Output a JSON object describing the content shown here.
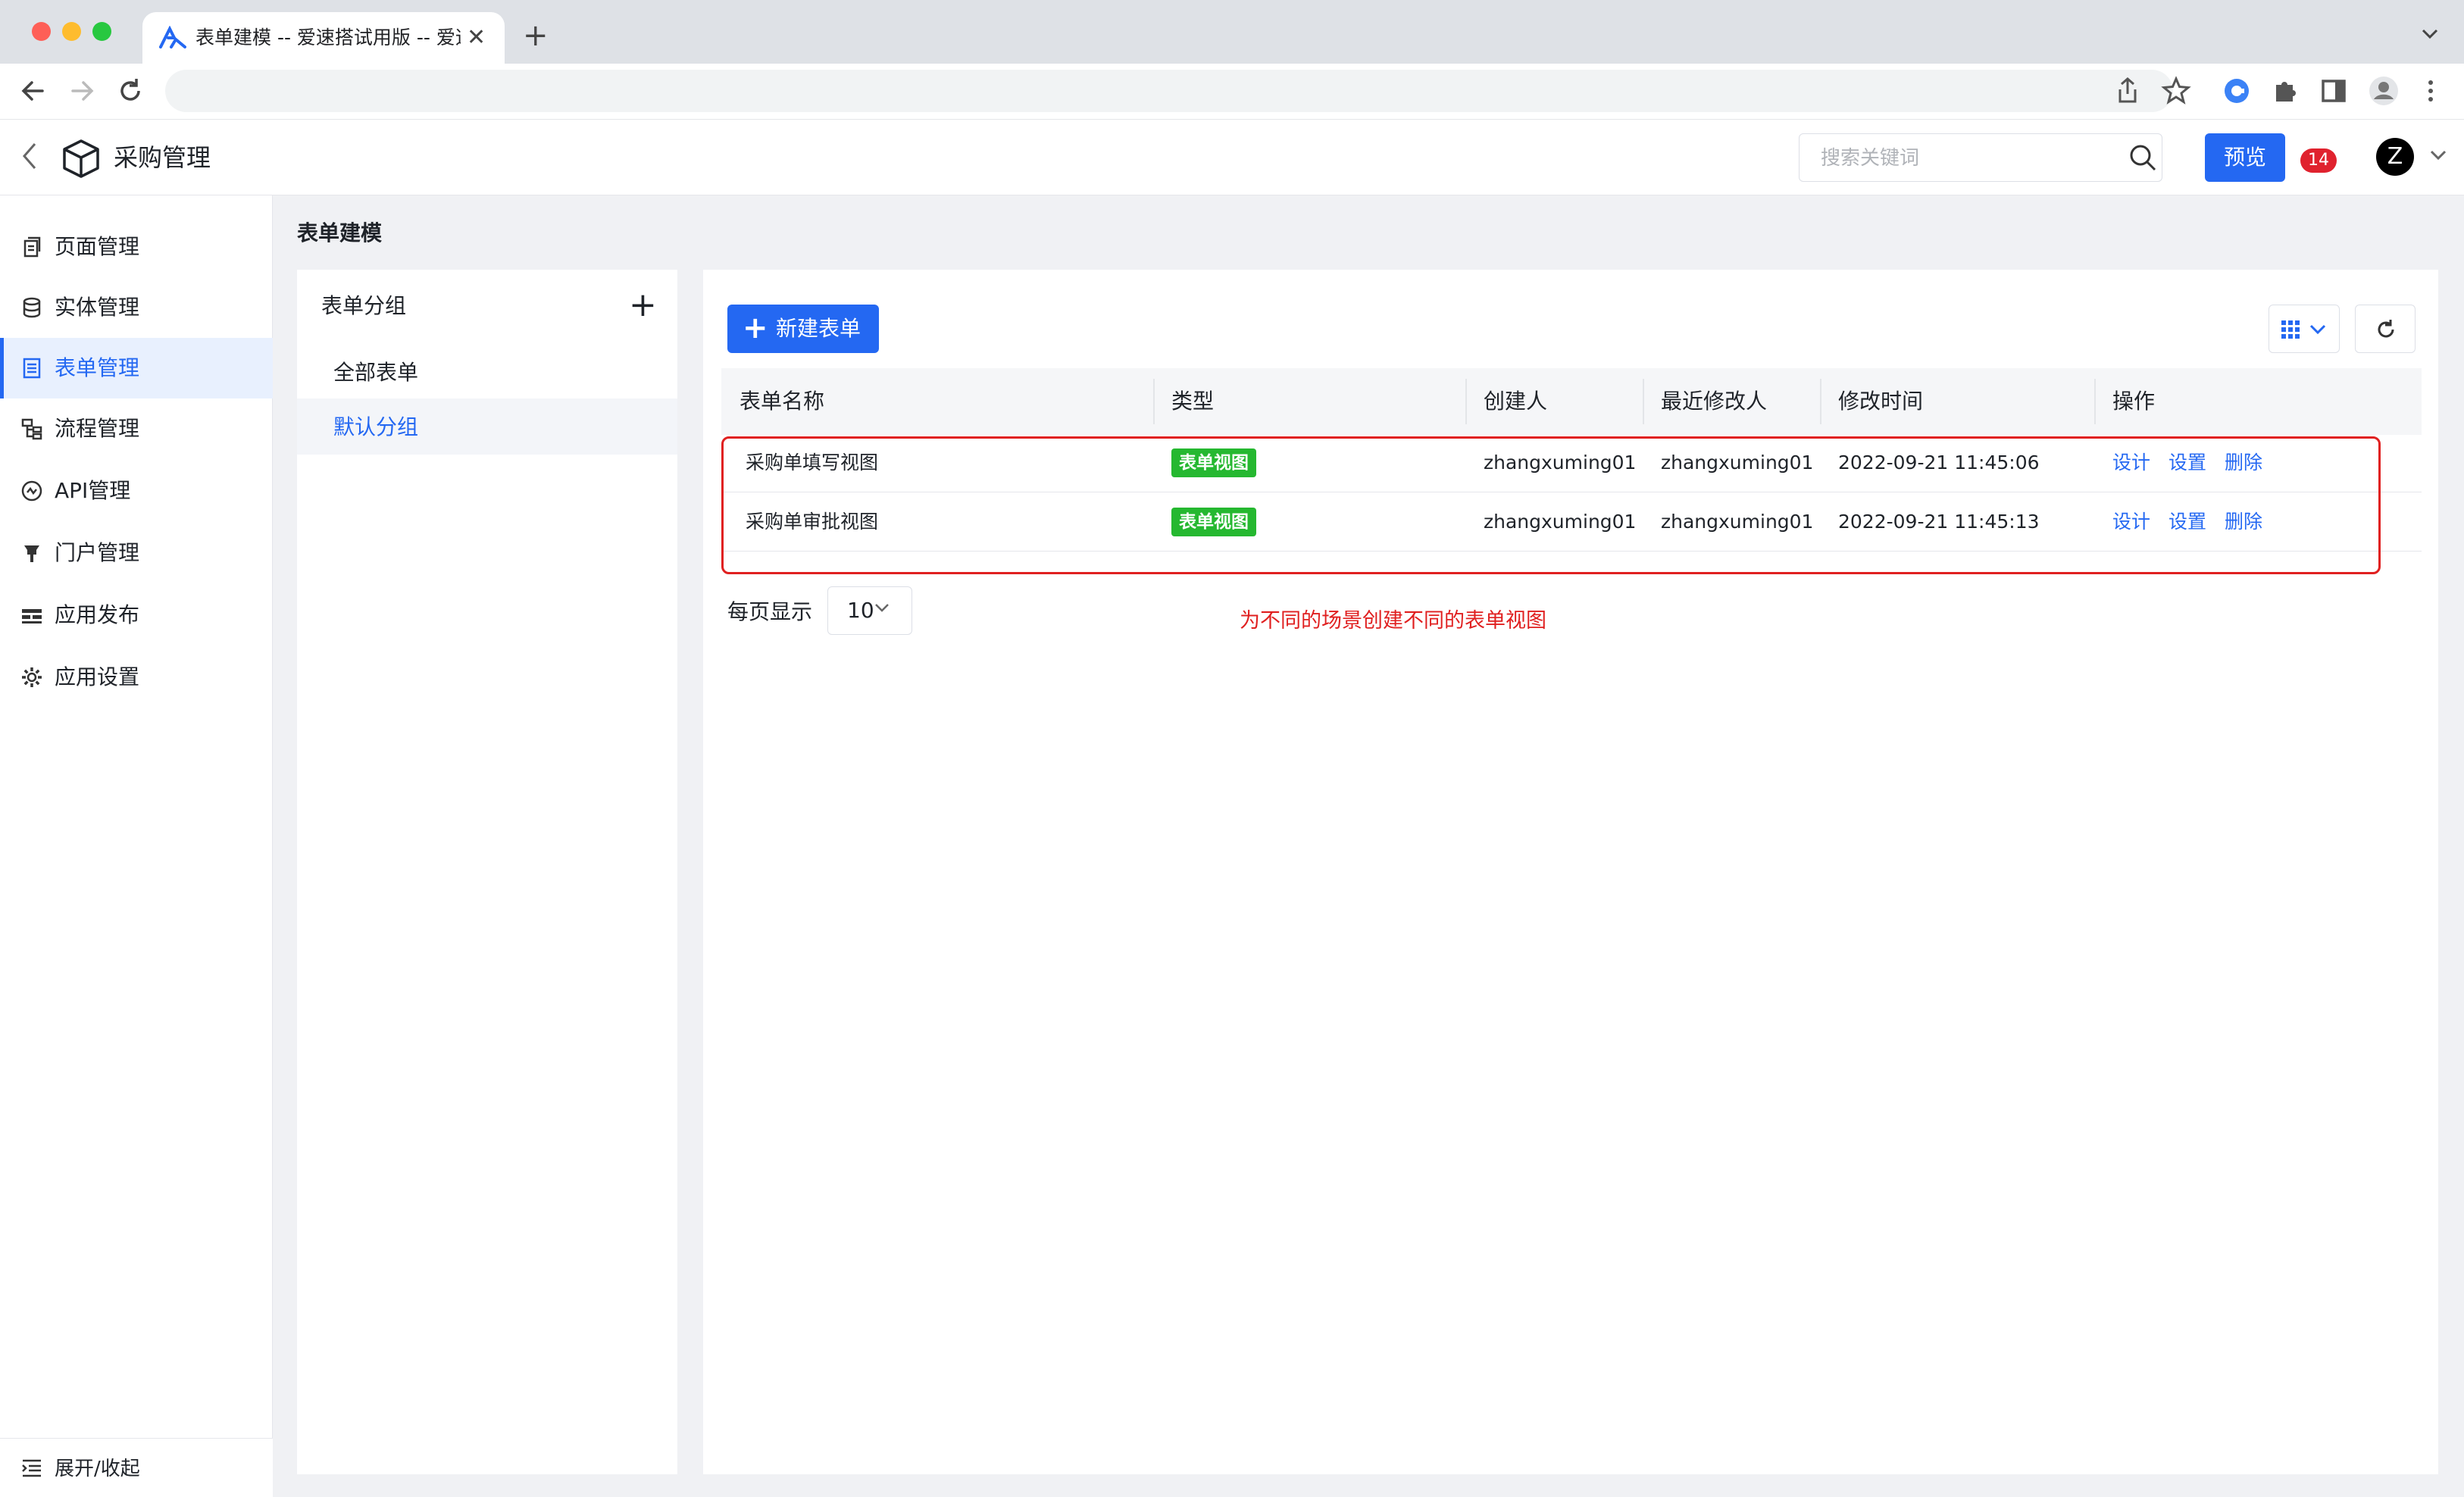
{
  "browser": {
    "tab_title": "表单建模 -- 爱速搭试用版 -- 爱速",
    "tab_close": "✕",
    "new_tab": "+",
    "url": ""
  },
  "header": {
    "app_title": "采购管理",
    "search_placeholder": "搜索关键词",
    "preview_label": "预览",
    "notification_count": "14",
    "avatar_initial": "Z"
  },
  "sidebar": {
    "items": [
      {
        "label": "页面管理",
        "icon": "page-icon",
        "active": false
      },
      {
        "label": "实体管理",
        "icon": "database-icon",
        "active": false
      },
      {
        "label": "表单管理",
        "icon": "form-icon",
        "active": true
      },
      {
        "label": "流程管理",
        "icon": "flow-icon",
        "active": false
      },
      {
        "label": "API管理",
        "icon": "api-icon",
        "active": false
      },
      {
        "label": "门户管理",
        "icon": "portal-icon",
        "active": false
      },
      {
        "label": "应用发布",
        "icon": "publish-icon",
        "active": false
      },
      {
        "label": "应用设置",
        "icon": "gear-icon",
        "active": false
      }
    ],
    "collapse_label": "展开/收起"
  },
  "breadcrumb": "表单建模",
  "groups": {
    "title": "表单分组",
    "add": "+",
    "items": [
      {
        "label": "全部表单",
        "active": false
      },
      {
        "label": "默认分组",
        "active": true
      }
    ]
  },
  "toolbar": {
    "new_form_label": "新建表单",
    "new_form_plus": "+"
  },
  "table": {
    "columns": [
      "表单名称",
      "类型",
      "创建人",
      "最近修改人",
      "修改时间",
      "操作"
    ],
    "rows": [
      {
        "name": "采购单填写视图",
        "type": "表单视图",
        "creator": "zhangxuming01",
        "modifier": "zhangxuming01",
        "time": "2022-09-21 11:45:06"
      },
      {
        "name": "采购单审批视图",
        "type": "表单视图",
        "creator": "zhangxuming01",
        "modifier": "zhangxuming01",
        "time": "2022-09-21 11:45:13"
      }
    ],
    "actions": [
      "设计",
      "设置",
      "删除"
    ]
  },
  "pagination": {
    "label": "每页显示",
    "per_page": "10"
  },
  "annotation": "为不同的场景创建不同的表单视图",
  "colors": {
    "accent": "#2468f2",
    "tag_green": "#25b830",
    "annotation_red": "#e02020"
  }
}
